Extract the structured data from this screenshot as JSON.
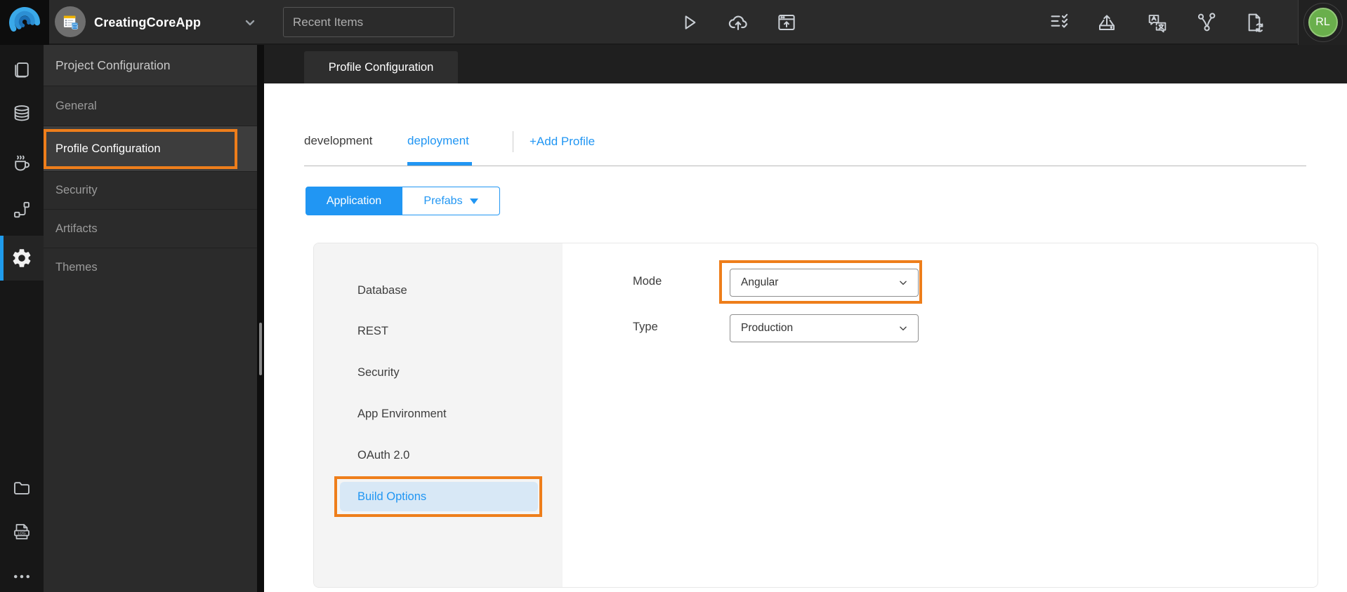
{
  "topbar": {
    "app_title": "CreatingCoreApp",
    "recent_items_label": "Recent Items",
    "avatar_initials": "RL",
    "icons": [
      "wavemaker-logo",
      "project-icon",
      "chevron-down",
      "run-play",
      "cloud-upload",
      "preview-window",
      "checklist",
      "export-app",
      "translate-chat",
      "branch-share",
      "file-sync"
    ]
  },
  "rail": {
    "items": [
      {
        "icon": "pages",
        "active": false
      },
      {
        "icon": "database",
        "active": false
      },
      {
        "icon": "java-services",
        "active": false
      },
      {
        "icon": "orchestration",
        "active": false
      },
      {
        "icon": "settings-gear",
        "active": true
      },
      {
        "icon": "file-explorer",
        "active": false
      },
      {
        "icon": "logs",
        "active": false
      },
      {
        "icon": "more-ellipsis",
        "active": false
      }
    ]
  },
  "sidebar": {
    "title": "Project Configuration",
    "items": [
      {
        "label": "General",
        "active": false
      },
      {
        "label": "Profile Configuration",
        "active": true,
        "annotated": true
      },
      {
        "label": "Security",
        "active": false
      },
      {
        "label": "Artifacts",
        "active": false
      },
      {
        "label": "Themes",
        "active": false
      }
    ]
  },
  "main": {
    "header_tab": "Profile Configuration",
    "profile_tabs": [
      {
        "label": "development",
        "active": false
      },
      {
        "label": "deployment",
        "active": true
      },
      {
        "label": "+Add Profile",
        "action": true
      }
    ],
    "scope_toggle": {
      "application": "Application",
      "prefabs": "Prefabs",
      "selected": "Application"
    },
    "settings_menu": {
      "items": [
        "Database",
        "REST",
        "Security",
        "App Environment",
        "OAuth 2.0",
        "Build Options"
      ],
      "active": "Build Options"
    },
    "form": {
      "mode_label": "Mode",
      "mode_value": "Angular",
      "type_label": "Type",
      "type_value": "Production"
    }
  },
  "colors": {
    "accent_blue": "#2196f3",
    "annotation_orange": "#ee7e1b",
    "avatar_green": "#6aaf4c",
    "active_menu_bg": "#d8e8f6"
  }
}
